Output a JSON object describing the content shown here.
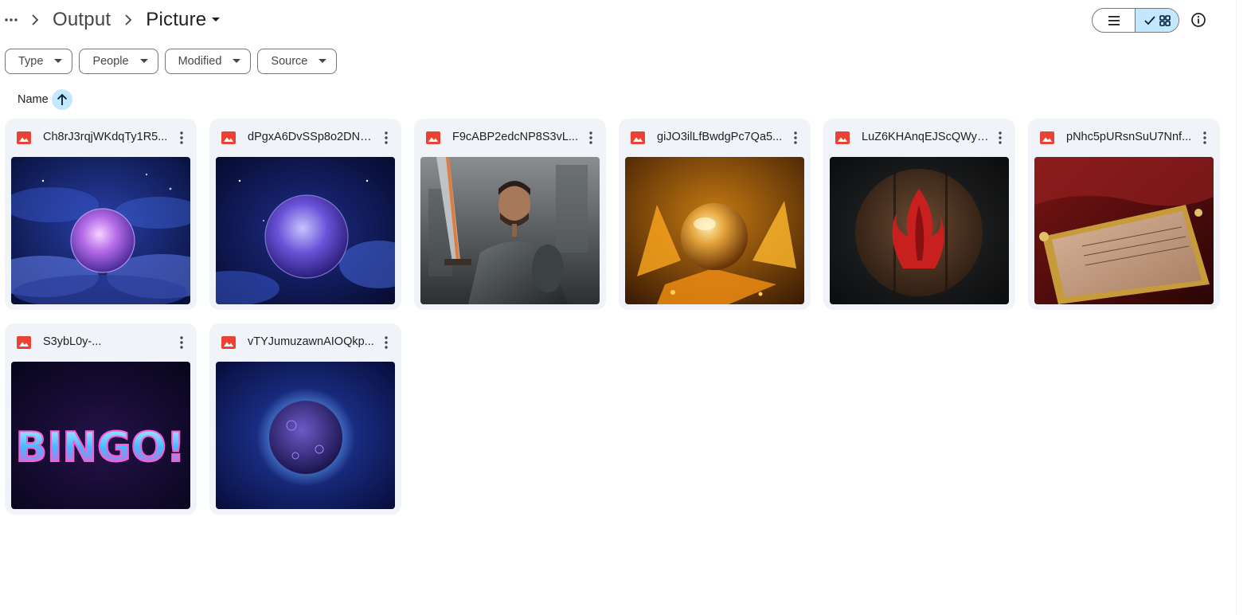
{
  "breadcrumb": {
    "more_icon": "more-horiz-icon",
    "items": [
      "Output",
      "Picture"
    ]
  },
  "toolbar": {
    "list_view_icon": "list-icon",
    "grid_view_icon": "grid-icon",
    "check_icon": "check-icon",
    "info_icon": "info-icon",
    "selected_view": "grid"
  },
  "filters": [
    "Type",
    "People",
    "Modified",
    "Source"
  ],
  "sort": {
    "label": "Name",
    "direction": "ascending",
    "icon": "arrow-up-icon"
  },
  "files": [
    {
      "name": "Ch8rJ3rqjWKdqTy1R5...",
      "thumb": "cosmic-orb-purple"
    },
    {
      "name": "dPgxA6DvSSp8o2DN8...",
      "thumb": "cosmic-orb-blue"
    },
    {
      "name": "F9cABP2edcNP8S3vL...",
      "thumb": "armored-knight"
    },
    {
      "name": "giJO3ilLfBwdgPc7Qa5...",
      "thumb": "golden-orb"
    },
    {
      "name": "LuZ6KHAnqEJScQWyI...",
      "thumb": "red-flame-emblem"
    },
    {
      "name": "pNhc5pURsnSuU7Nnf...",
      "thumb": "ornate-golden-frame"
    },
    {
      "name": "S3ybL0y-...",
      "thumb": "bingo-neon-text",
      "text": "BINGO!"
    },
    {
      "name": "vTYJumuzawnAIOQkp...",
      "thumb": "dark-planet-orb"
    }
  ],
  "colors": {
    "accent": "#c2e7ff",
    "card_bg": "#f0f4f9",
    "image_icon": "#ea4335",
    "border": "#747775"
  }
}
